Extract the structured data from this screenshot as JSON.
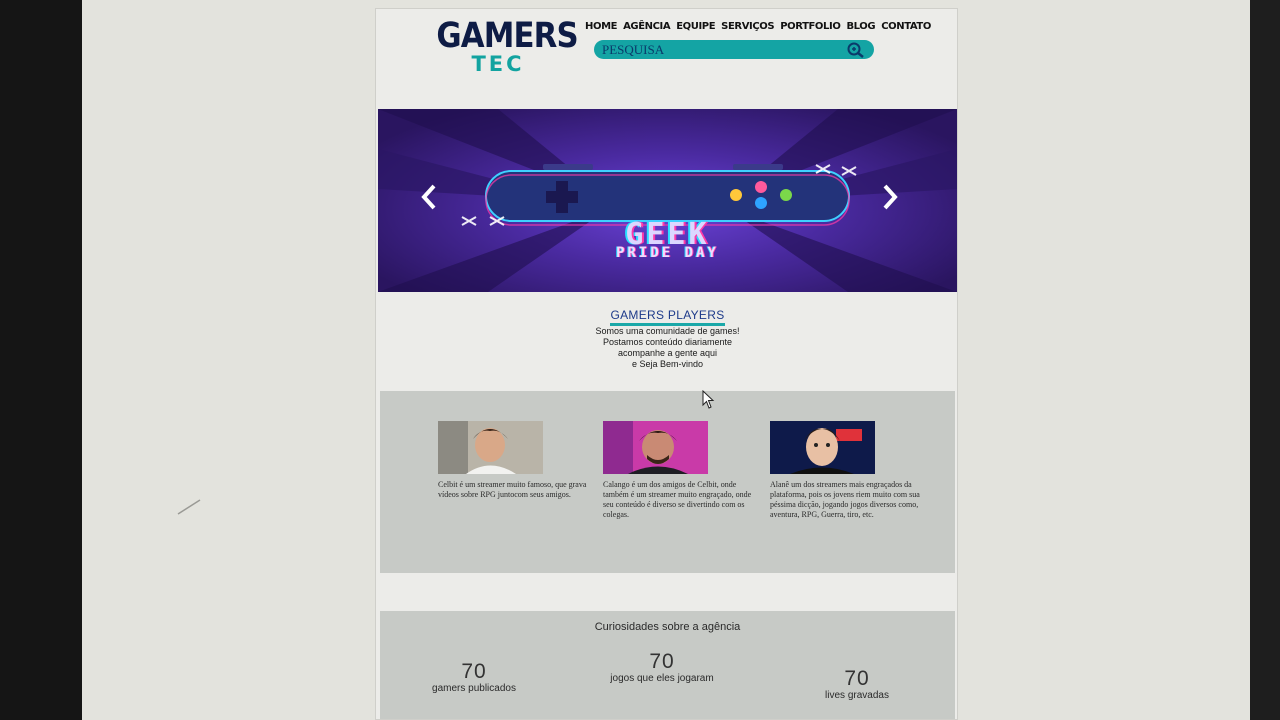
{
  "logo": {
    "main": "GAMERS",
    "sub": "TEC"
  },
  "nav": [
    "HOME",
    "AGÊNCIA",
    "EQUIPE",
    "SERVIÇOS",
    "PORTFOLIO",
    "BLOG",
    "CONTATO"
  ],
  "search": {
    "placeholder": "PESQUISA",
    "icon": "search-icon"
  },
  "banner": {
    "title": "GEEK",
    "subtitle": "PRIDE DAY"
  },
  "intro": {
    "title": "GAMERS PLAYERS",
    "lines": [
      "Somos uma comunidade de games!",
      "Postamos conteúdo diariamente",
      "acompanhe a gente aqui",
      "e Seja Bem-vindo"
    ]
  },
  "team": [
    {
      "bio": "Celbit é um streamer muito famoso, que grava vídeos sobre RPG juntocom seus amigos."
    },
    {
      "bio": "Calango é um dos amigos de Celbit, onde também é um streamer muito engraçado, onde seu conteúdo é diverso se divertindo com os colegas."
    },
    {
      "bio": "Alanê um dos streamers mais engraçados da plataforma, pois os jovens riem muito com sua péssima dicção, jogando jogos diversos como, aventura, RPG, Guerra, tiro, etc."
    }
  ],
  "curiosidades": {
    "title": "Curiosidades sobre a agência",
    "stats": [
      {
        "number": "70",
        "label": "gamers publicados"
      },
      {
        "number": "70",
        "label": "jogos que eles jogaram"
      },
      {
        "number": "70",
        "label": "lives gravadas"
      }
    ]
  },
  "colors": {
    "navy": "#0e1c45",
    "teal": "#14a4a4",
    "band": "#c7cac6"
  }
}
